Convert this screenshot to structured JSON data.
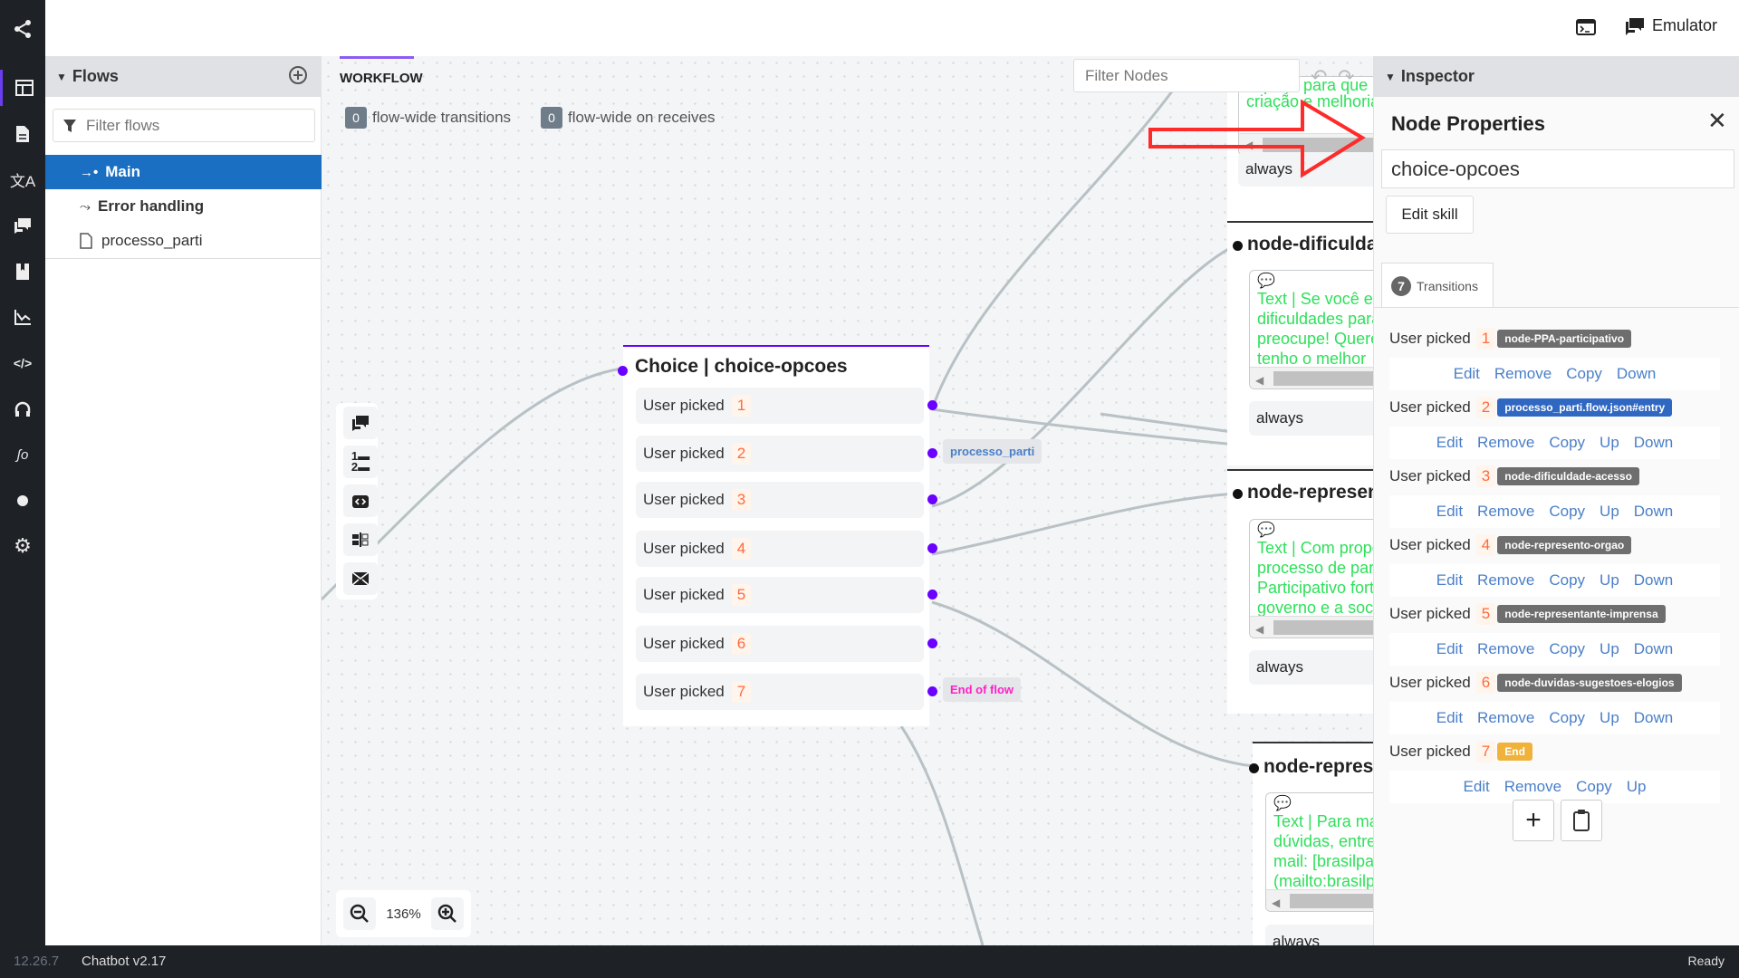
{
  "iconbar": {
    "items": [
      "share-icon",
      "layout-icon",
      "document-icon",
      "translate-icon",
      "chat-icon",
      "book-icon",
      "chart-icon",
      "code-icon",
      "headset-icon",
      "signature-icon",
      "circle-icon",
      "gear-icon"
    ]
  },
  "topbar": {
    "terminal_icon": "terminal-icon",
    "emulator_label": "Emulator"
  },
  "flows": {
    "title": "Flows",
    "filter_placeholder": "Filter flows",
    "items": [
      {
        "label": "Main",
        "icon": "entry-icon",
        "selected": true
      },
      {
        "label": "Error handling",
        "icon": "error-route-icon"
      },
      {
        "label": "processo_parti",
        "icon": "file-icon"
      }
    ]
  },
  "workflow": {
    "tab": "WORKFLOW",
    "filter_nodes_placeholder": "Filter Nodes",
    "flow_wide_transitions_count": "0",
    "flow_wide_transitions_label": "flow-wide transitions",
    "flow_wide_receives_count": "0",
    "flow_wide_receives_label": "flow-wide on receives",
    "zoom": "136%",
    "choice_node": {
      "title": "Choice | choice-opcoes",
      "rows": [
        {
          "label": "User picked",
          "num": "1"
        },
        {
          "label": "User picked",
          "num": "2",
          "tag": "processo_parti"
        },
        {
          "label": "User picked",
          "num": "3"
        },
        {
          "label": "User picked",
          "num": "4"
        },
        {
          "label": "User picked",
          "num": "5"
        },
        {
          "label": "User picked",
          "num": "6"
        },
        {
          "label": "User picked",
          "num": "7",
          "tag": "End of flow"
        }
      ]
    },
    "right_nodes": [
      {
        "title": "",
        "text": [
          "espaço para que",
          "criação e melhoria"
        ],
        "always": "always"
      },
      {
        "title": "node-dificuldade",
        "text": [
          "Text | Se você es",
          "dificuldades para",
          "preocupe! Querem",
          "tenho o melhor"
        ],
        "always": "always"
      },
      {
        "title": "node-represent",
        "text": [
          "Text | Com propó",
          "processo de part",
          "Participativo fort",
          "governo e a socie"
        ],
        "always": "always"
      },
      {
        "title": "node-represe",
        "text": [
          "Text | Para ma",
          "dúvidas, entre",
          "mail: [brasilpar",
          "(mailto:brasilp"
        ],
        "always": "always"
      }
    ]
  },
  "inspector": {
    "title": "Inspector",
    "panel_title": "Node Properties",
    "node_name": "choice-opcoes",
    "edit_skill": "Edit skill",
    "transitions_count": "7",
    "transitions_tab": "Transitions",
    "transitions": [
      {
        "label": "User picked",
        "num": "1",
        "target": "node-PPA-participativo",
        "actions": [
          "Edit",
          "Remove",
          "Copy",
          "Down"
        ]
      },
      {
        "label": "User picked",
        "num": "2",
        "target": "processo_parti.flow.json#entry",
        "target_color": "#2f67c1",
        "actions": [
          "Edit",
          "Remove",
          "Copy",
          "Up",
          "Down"
        ]
      },
      {
        "label": "User picked",
        "num": "3",
        "target": "node-dificuldade-acesso",
        "actions": [
          "Edit",
          "Remove",
          "Copy",
          "Up",
          "Down"
        ]
      },
      {
        "label": "User picked",
        "num": "4",
        "target": "node-represento-orgao",
        "actions": [
          "Edit",
          "Remove",
          "Copy",
          "Up",
          "Down"
        ]
      },
      {
        "label": "User picked",
        "num": "5",
        "target": "node-representante-imprensa",
        "actions": [
          "Edit",
          "Remove",
          "Copy",
          "Up",
          "Down"
        ]
      },
      {
        "label": "User picked",
        "num": "6",
        "target": "node-duvidas-sugestoes-elogios",
        "actions": [
          "Edit",
          "Remove",
          "Copy",
          "Up",
          "Down"
        ]
      },
      {
        "label": "User picked",
        "num": "7",
        "target": "End",
        "target_color": "#f0b23a",
        "actions": [
          "Edit",
          "Remove",
          "Copy",
          "Up"
        ]
      }
    ]
  },
  "status": {
    "version": "12.26.7",
    "bot": "Chatbot v2.17",
    "state": "Ready"
  },
  "colors": {
    "accent": "#6a00ff",
    "selected": "#1a6fc2",
    "link": "#4a7fc8",
    "number": "#ff6a3d",
    "annotation_arrow": "#ff2a2a"
  }
}
